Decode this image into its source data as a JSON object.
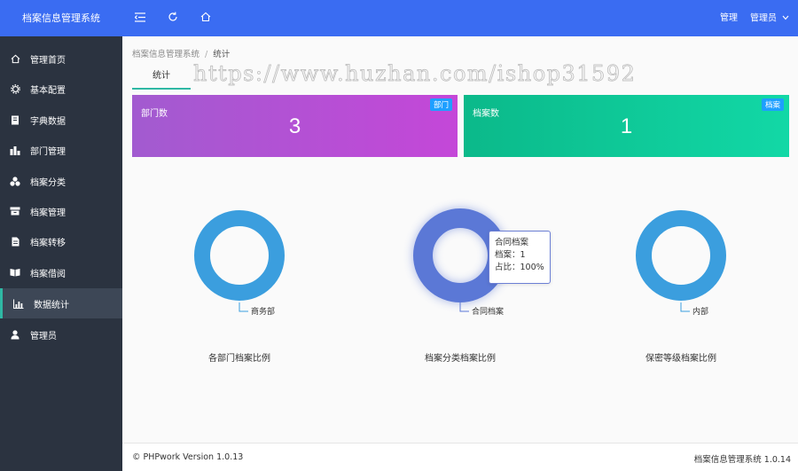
{
  "app": {
    "title": "档案信息管理系统"
  },
  "topbar": {
    "right_link": "管理",
    "user_menu": "管理员"
  },
  "sidebar": {
    "items": [
      {
        "label": "管理首页",
        "icon": "home-icon"
      },
      {
        "label": "基本配置",
        "icon": "gear-icon"
      },
      {
        "label": "字典数据",
        "icon": "book-icon"
      },
      {
        "label": "部门管理",
        "icon": "org-icon"
      },
      {
        "label": "档案分类",
        "icon": "cubes-icon"
      },
      {
        "label": "档案管理",
        "icon": "archive-icon"
      },
      {
        "label": "档案转移",
        "icon": "file-icon"
      },
      {
        "label": "档案借阅",
        "icon": "open-book-icon"
      },
      {
        "label": "数据统计",
        "icon": "chart-icon",
        "active": true
      },
      {
        "label": "管理员",
        "icon": "user-icon"
      }
    ]
  },
  "breadcrumb": {
    "root": "档案信息管理系统",
    "sep": "/",
    "current": "统计"
  },
  "tab": {
    "label": "统计"
  },
  "watermark": "https://www.huzhan.com/ishop31592",
  "cards": [
    {
      "title": "部门数",
      "value": "3",
      "badge": "部门",
      "gradient": [
        "#a25bd0",
        "#c447d8"
      ]
    },
    {
      "title": "档案数",
      "value": "1",
      "badge": "档案",
      "gradient": [
        "#0bb98a",
        "#12d8a6"
      ]
    }
  ],
  "charts": [
    {
      "title": "各部门档案比例",
      "slice_label": "商务部",
      "color": "#3b9ede"
    },
    {
      "title": "档案分类档案比例",
      "slice_label": "合同档案",
      "color": "#5b78d6"
    },
    {
      "title": "保密等级档案比例",
      "slice_label": "内部",
      "color": "#3b9ede"
    }
  ],
  "tooltip": {
    "title": "合同档案",
    "line1": "档案：1",
    "line2": "占比：100%"
  },
  "chart_data": [
    {
      "type": "pie",
      "title": "各部门档案比例",
      "categories": [
        "商务部"
      ],
      "values": [
        1
      ]
    },
    {
      "type": "pie",
      "title": "档案分类档案比例",
      "categories": [
        "合同档案"
      ],
      "values": [
        1
      ],
      "percent": [
        100
      ]
    },
    {
      "type": "pie",
      "title": "保密等级档案比例",
      "categories": [
        "内部"
      ],
      "values": [
        1
      ]
    }
  ],
  "footer": {
    "left": "© PHPwork Version 1.0.13",
    "right": "档案信息管理系统 1.0.14"
  }
}
